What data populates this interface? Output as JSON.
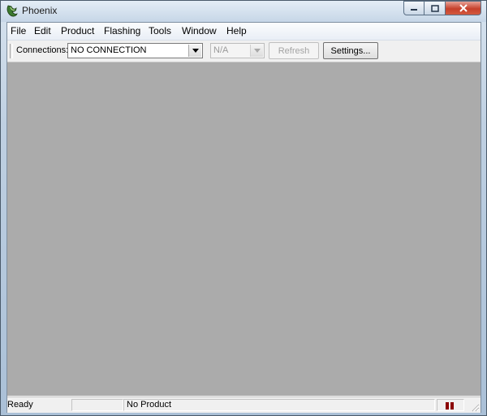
{
  "window": {
    "title": "Phoenix",
    "icon": "phoenix-app-icon"
  },
  "menubar": {
    "items": [
      {
        "label": "File"
      },
      {
        "label": "Edit"
      },
      {
        "label": "Product"
      },
      {
        "label": "Flashing"
      },
      {
        "label": "Tools"
      },
      {
        "label": "Window"
      },
      {
        "label": "Help"
      }
    ]
  },
  "toolbar": {
    "connections_label": "Connections:",
    "connection_value": "NO CONNECTION",
    "secondary_value": "N/A",
    "refresh_label": "Refresh",
    "settings_label": "Settings..."
  },
  "statusbar": {
    "ready_text": "Ready",
    "product_text": "No Product",
    "indicator_color": "#8b0000"
  },
  "colors": {
    "workspace": "#ababab",
    "close_button": "#c6402b"
  }
}
